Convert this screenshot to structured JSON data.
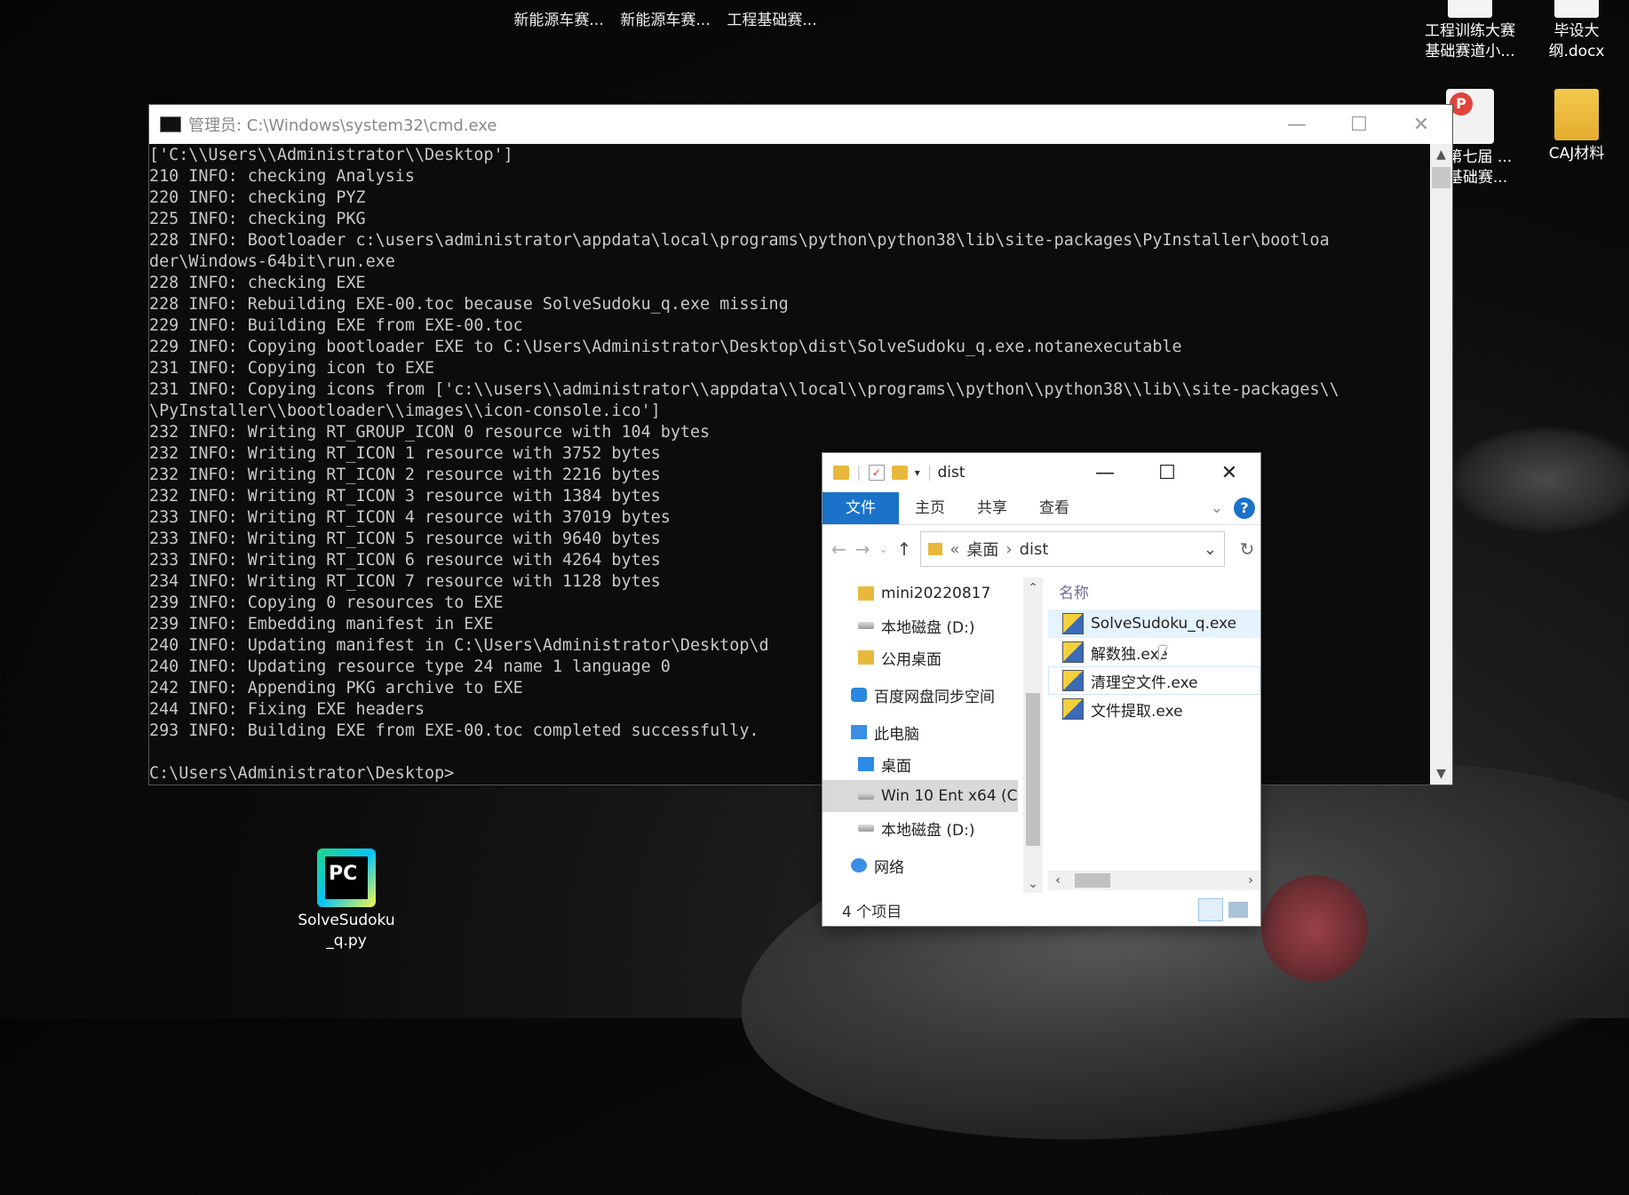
{
  "desktop": {
    "top_partial_labels": [
      "新能源车赛...",
      "新能源车赛...",
      "工程基础赛..."
    ],
    "right_icons": [
      {
        "label": "工程训练大赛基础赛道小...",
        "icon": "doc-icon"
      },
      {
        "label": "毕设大纲.docx",
        "icon": "doc-icon"
      },
      {
        "label": "20第七届 ...理基础赛...",
        "icon": "pdf-icon"
      },
      {
        "label": "CAJ材料",
        "icon": "folder-icon"
      }
    ],
    "pycharm_icon": {
      "label": "SolveSudoku_q.py",
      "glyph": "PC",
      "icon": "pycharm-icon"
    }
  },
  "cmd": {
    "title": "管理员: C:\\Windows\\system32\\cmd.exe",
    "lines": [
      "['C:\\\\Users\\\\Administrator\\\\Desktop']",
      "210 INFO: checking Analysis",
      "220 INFO: checking PYZ",
      "225 INFO: checking PKG",
      "228 INFO: Bootloader c:\\users\\administrator\\appdata\\local\\programs\\python\\python38\\lib\\site-packages\\PyInstaller\\bootloa",
      "der\\Windows-64bit\\run.exe",
      "228 INFO: checking EXE",
      "228 INFO: Rebuilding EXE-00.toc because SolveSudoku_q.exe missing",
      "229 INFO: Building EXE from EXE-00.toc",
      "229 INFO: Copying bootloader EXE to C:\\Users\\Administrator\\Desktop\\dist\\SolveSudoku_q.exe.notanexecutable",
      "231 INFO: Copying icon to EXE",
      "231 INFO: Copying icons from ['c:\\\\users\\\\administrator\\\\appdata\\\\local\\\\programs\\\\python\\\\python38\\\\lib\\\\site-packages\\\\",
      "\\PyInstaller\\\\bootloader\\\\images\\\\icon-console.ico']",
      "232 INFO: Writing RT_GROUP_ICON 0 resource with 104 bytes",
      "232 INFO: Writing RT_ICON 1 resource with 3752 bytes",
      "232 INFO: Writing RT_ICON 2 resource with 2216 bytes",
      "232 INFO: Writing RT_ICON 3 resource with 1384 bytes",
      "233 INFO: Writing RT_ICON 4 resource with 37019 bytes",
      "233 INFO: Writing RT_ICON 5 resource with 9640 bytes",
      "233 INFO: Writing RT_ICON 6 resource with 4264 bytes",
      "234 INFO: Writing RT_ICON 7 resource with 1128 bytes",
      "239 INFO: Copying 0 resources to EXE",
      "239 INFO: Embedding manifest in EXE",
      "240 INFO: Updating manifest in C:\\Users\\Administrator\\Desktop\\d",
      "240 INFO: Updating resource type 24 name 1 language 0",
      "242 INFO: Appending PKG archive to EXE",
      "244 INFO: Fixing EXE headers",
      "293 INFO: Building EXE from EXE-00.toc completed successfully.",
      "",
      "C:\\Users\\Administrator\\Desktop>"
    ]
  },
  "explorer": {
    "title": "dist",
    "ribbon_tabs": [
      "文件",
      "主页",
      "共享",
      "查看"
    ],
    "address": {
      "prefix": "«",
      "parts": [
        "桌面",
        "dist"
      ]
    },
    "nav_items": [
      {
        "label": "mini20220817",
        "icon": "folder-icon"
      },
      {
        "label": "本地磁盘 (D:)",
        "icon": "drive-icon"
      },
      {
        "label": "公用桌面",
        "icon": "folder-icon"
      },
      {
        "label": "百度网盘同步空间",
        "icon": "cloud-icon"
      },
      {
        "label": "此电脑",
        "icon": "pc-icon"
      },
      {
        "label": "桌面",
        "icon": "desktop-icon"
      },
      {
        "label": "Win 10 Ent x64 (C",
        "icon": "drive-icon"
      },
      {
        "label": "本地磁盘 (D:)",
        "icon": "drive-icon"
      },
      {
        "label": "网络",
        "icon": "network-icon"
      }
    ],
    "column_header": "名称",
    "files": [
      "SolveSudoku_q.exe",
      "解数独.exe",
      "清理空文件.exe",
      "文件提取.exe"
    ],
    "status": "4 个项目"
  }
}
